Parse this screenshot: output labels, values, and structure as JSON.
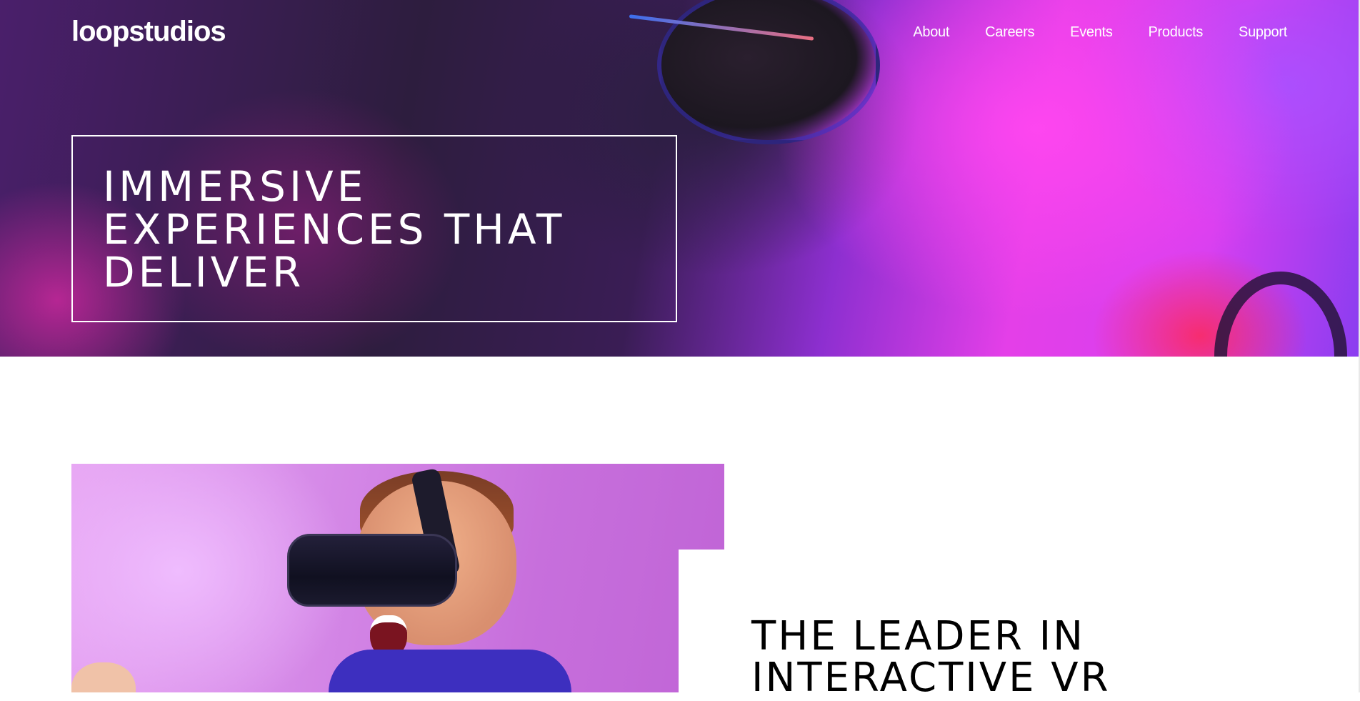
{
  "header": {
    "logo": "loopstudios",
    "nav": [
      {
        "label": "About"
      },
      {
        "label": "Careers"
      },
      {
        "label": "Events"
      },
      {
        "label": "Products"
      },
      {
        "label": "Support"
      }
    ]
  },
  "hero": {
    "title_lines": [
      "IMMERSIVE",
      "EXPERIENCES THAT",
      "DELIVER"
    ]
  },
  "intro": {
    "title_lines": [
      "THE LEADER IN",
      "INTERACTIVE VR"
    ]
  },
  "colors": {
    "hero_text": "#ffffff",
    "body_text": "#000000",
    "background": "#ffffff",
    "accent_pink": "#e43fe8",
    "accent_violet": "#8a3df0"
  },
  "icons": {
    "hero_image": "vr-headset-woman-image",
    "feature_image": "vr-headset-man-image"
  }
}
